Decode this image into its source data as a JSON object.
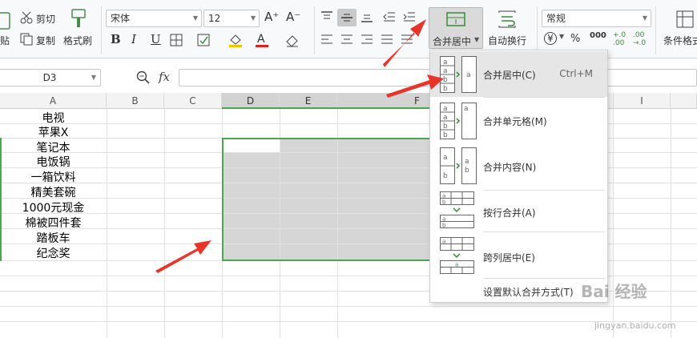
{
  "ribbon": {
    "clipboard": {
      "cut": "剪切",
      "copy": "复制",
      "format_painter": "格式刷",
      "paste_partial": "贴"
    },
    "font": {
      "name": "宋体",
      "size": "12",
      "bold": "B",
      "italic": "I",
      "underline": "U",
      "grow": "A⁺",
      "shrink": "A⁻"
    },
    "merge_label": "合并居中",
    "wrap_label": "自动换行",
    "number_format": "常规",
    "currency_symbol": "¥",
    "percent_symbol": "%",
    "thousands_label": "000",
    "increase_decimal": "+.0 .00",
    "decrease_decimal": ".00 →.0",
    "conditional_label": "条件格式"
  },
  "formula_bar": {
    "name_box": "D3",
    "fx": "fx"
  },
  "columns": [
    "A",
    "B",
    "C",
    "D",
    "E",
    "F",
    "I"
  ],
  "cells": [
    "电视",
    "苹果X",
    "笔记本",
    "电饭锅",
    "一箱饮料",
    "精美套碗",
    "1000元现金",
    "棉被四件套",
    "踏板车",
    "纪念奖"
  ],
  "merge_menu": {
    "items": [
      {
        "label": "合并居中(C)",
        "shortcut": "Ctrl+M"
      },
      {
        "label": "合并单元格(M)",
        "shortcut": ""
      },
      {
        "label": "合并内容(N)",
        "shortcut": ""
      },
      {
        "label": "按行合并(A)",
        "shortcut": ""
      },
      {
        "label": "跨列居中(E)",
        "shortcut": ""
      }
    ],
    "footer": "设置默认合并方式(T)"
  },
  "watermark": {
    "text": "Bai 经验",
    "url": "jingyan.baidu.com"
  },
  "colors": {
    "accent_green": "#4ca64c",
    "arrow_red": "#e8352a",
    "selection_gray": "#d6d6d6"
  }
}
